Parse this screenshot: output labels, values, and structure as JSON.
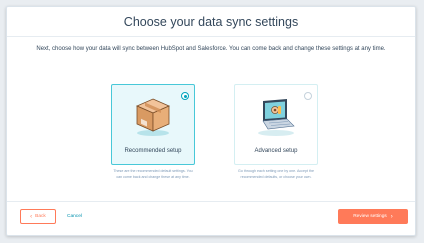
{
  "dialog": {
    "title": "Choose your data sync settings",
    "subtitle": "Next, choose how your data will sync between HubSpot and Salesforce. You can come back and change these settings at any time."
  },
  "options": [
    {
      "label": "Recommended setup",
      "selected": true,
      "icon": "box-icon",
      "description": "These are the recommended default settings. You can come back and change these at any time."
    },
    {
      "label": "Advanced setup",
      "selected": false,
      "icon": "laptop-settings-icon",
      "description": "Go through each setting one by one. Accept the recommended defaults, or choose your own."
    }
  ],
  "footer": {
    "back_label": "Back",
    "cancel_label": "Cancel",
    "review_label": "Review settings"
  },
  "colors": {
    "accent_orange": "#ff7a59",
    "accent_teal": "#00a4bd",
    "text_dark": "#33475b",
    "text_muted": "#7c98b6"
  }
}
